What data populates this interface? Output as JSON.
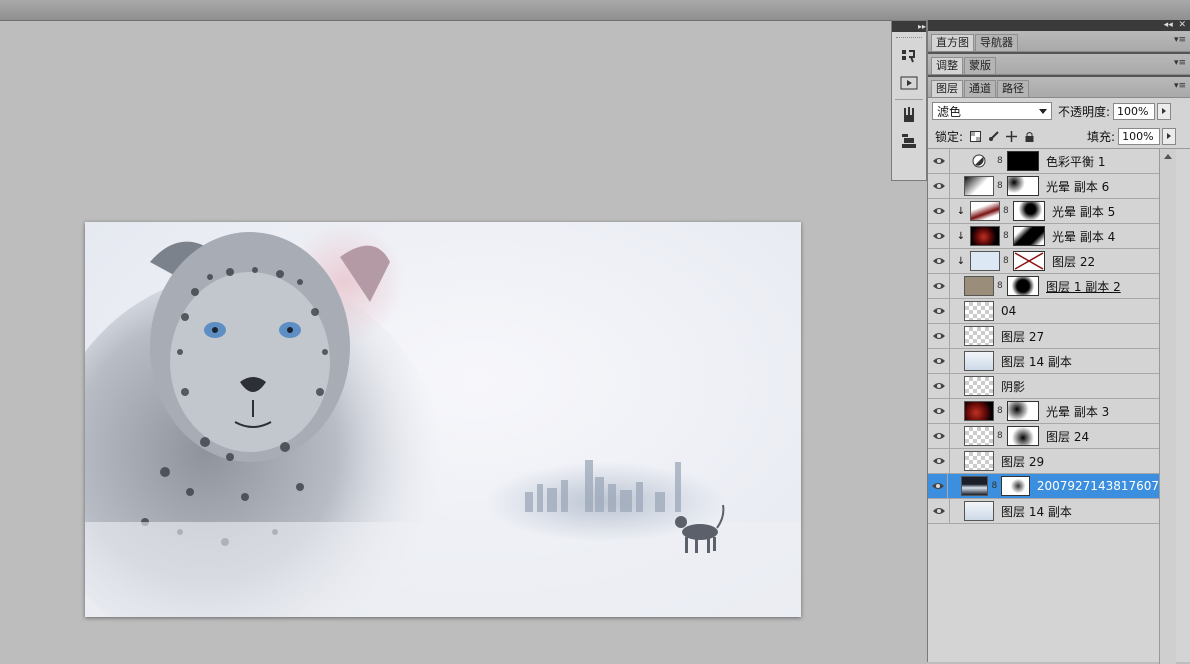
{
  "panel": {
    "tab_groups": [
      {
        "tabs": [
          "直方图",
          "导航器"
        ],
        "active": 0
      },
      {
        "tabs": [
          "调整",
          "蒙版"
        ],
        "active": 0
      },
      {
        "tabs": [
          "图层",
          "通道",
          "路径"
        ],
        "active": 0
      }
    ],
    "blend_mode": "滤色",
    "opacity_label": "不透明度:",
    "opacity_value": "100%",
    "lock_label": "锁定:",
    "fill_label": "填充:",
    "fill_value": "100%"
  },
  "layers": [
    {
      "name": "色彩平衡 1",
      "type": "adjustment",
      "clip": false,
      "selected": false
    },
    {
      "name": "光晕 副本 6",
      "type": "masked",
      "clip": false,
      "selected": false
    },
    {
      "name": "光晕 副本 5",
      "type": "masked",
      "clip": true,
      "selected": false
    },
    {
      "name": "光晕 副本 4",
      "type": "masked",
      "clip": true,
      "selected": false
    },
    {
      "name": "图层 22",
      "type": "masked",
      "clip": true,
      "selected": false
    },
    {
      "name": "图层 1 副本 2",
      "type": "masked",
      "clip": false,
      "selected": false
    },
    {
      "name": "04",
      "type": "plain",
      "clip": false,
      "selected": false
    },
    {
      "name": "图层 27",
      "type": "plain",
      "clip": false,
      "selected": false
    },
    {
      "name": "图层 14 副本",
      "type": "plain",
      "clip": false,
      "selected": false
    },
    {
      "name": "阴影",
      "type": "plain",
      "clip": false,
      "selected": false
    },
    {
      "name": "光晕 副本 3",
      "type": "masked",
      "clip": false,
      "selected": false
    },
    {
      "name": "图层 24",
      "type": "masked",
      "clip": false,
      "selected": false
    },
    {
      "name": "图层 29",
      "type": "plain",
      "clip": false,
      "selected": false
    },
    {
      "name": "2007927143817607",
      "type": "masked",
      "clip": false,
      "selected": true
    },
    {
      "name": "图层 14 副本",
      "type": "plain",
      "clip": false,
      "selected": false
    }
  ],
  "colors": {
    "selection": "#3b8fde",
    "panel_bg": "#d4d4d4",
    "workspace": "#bdbdbd"
  },
  "dock_icons": [
    "history-icon",
    "actions-play-icon",
    "brushes-icon",
    "clone-source-icon"
  ]
}
